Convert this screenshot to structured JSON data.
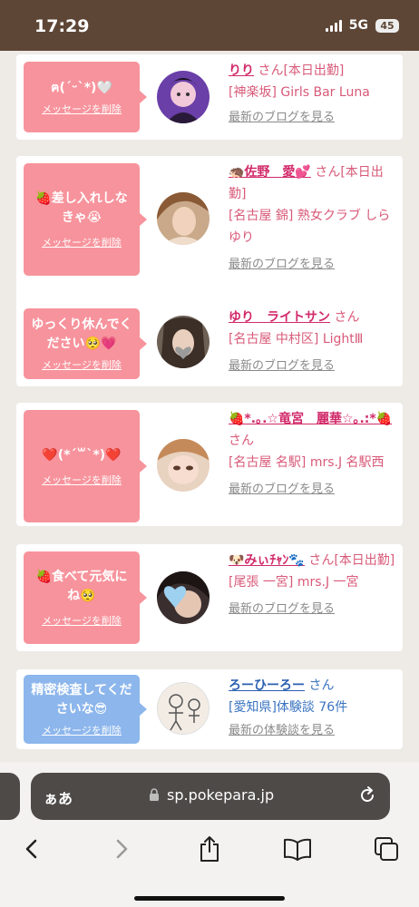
{
  "status": {
    "time": "17:29",
    "network": "5G",
    "battery": "45"
  },
  "entries": [
    {
      "message": "ฅ(ˊᵕˋ*)🤍",
      "delete_label": "メッセージを削除",
      "name": "りり",
      "san": "さん[本日出勤]",
      "location": "[神楽坂] Girls Bar Luna",
      "blog_link": "最新のブログを見る",
      "bubble_color": "#f7939c"
    },
    {
      "message": "🍓差し入れしなきゃ😭",
      "delete_label": "メッセージを削除",
      "name": "🦔佐野　愛💕",
      "san": "さん[本日出勤]",
      "location": "[名古屋 錦] 熟女クラブ しらゆり",
      "blog_link": "最新のブログを見る",
      "bubble_color": "#f7939c"
    },
    {
      "message": "ゆっくり休んでください🥺💗",
      "delete_label": "メッセージを削除",
      "name": "ゆり　ライトサン",
      "san": "さん",
      "location": "[名古屋 中村区] LightⅢ",
      "blog_link": "最新のブログを見る",
      "bubble_color": "#f7939c"
    },
    {
      "message": "❤️(*´꒳`*)❤️",
      "delete_label": "メッセージを削除",
      "name": "🍓*.｡.☆竜宮　麗華☆｡.:*🍓",
      "san": "さん",
      "location": "[名古屋 名駅] mrs.J 名駅西",
      "blog_link": "最新のブログを見る",
      "bubble_color": "#f7939c"
    },
    {
      "message": "🍓食べて元気にね🥺",
      "delete_label": "メッセージを削除",
      "name": "🐶みぃﾁｬﾝ🐾",
      "san": "さん[本日出勤]",
      "location": "[尾張 一宮] mrs.J 一宮",
      "blog_link": "最新のブログを見る",
      "bubble_color": "#f7939c"
    },
    {
      "message": "精密検査してくださいな😎",
      "delete_label": "メッセージを削除",
      "name": "ろーひーろー",
      "san": "さん",
      "location": "[愛知県]体験談 76件",
      "blog_link": "最新の体験談を見る",
      "bubble_color": "#8cb6ec"
    }
  ],
  "browser": {
    "aa_label": "ぁあ",
    "url": "sp.pokepara.jp"
  },
  "icons": [
    "lock-icon",
    "reload-icon",
    "back-icon",
    "forward-icon",
    "share-icon",
    "bookmarks-icon",
    "tabs-icon"
  ]
}
